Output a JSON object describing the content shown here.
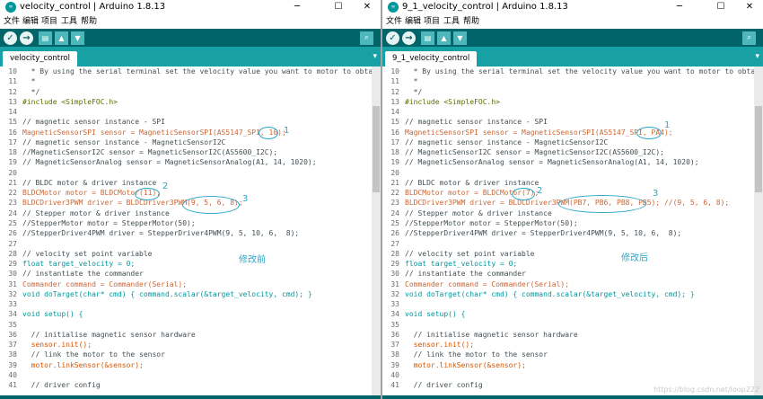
{
  "left": {
    "title": "velocity_control | Arduino 1.8.13",
    "tab": "velocity_control",
    "annotation": "修改前",
    "marks": [
      "1",
      "2",
      "3"
    ]
  },
  "right": {
    "title": "9_1_velocity_control | Arduino 1.8.13",
    "tab": "9_1_velocity_control",
    "annotation": "修改后",
    "marks": [
      "1",
      "2",
      "3"
    ]
  },
  "menu": [
    "文件",
    "编辑",
    "项目",
    "工具",
    "帮助"
  ],
  "window_controls": [
    "─",
    "☐",
    "✕"
  ],
  "icons": {
    "app": "arduino-logo-icon",
    "verify": "verify-check-icon",
    "upload": "upload-arrow-icon",
    "new": "new-file-icon",
    "open": "open-up-icon",
    "save": "save-down-icon",
    "monitor": "serial-monitor-icon",
    "tabmenu": "tab-menu-icon"
  },
  "code_left": [
    {
      "n": "10",
      "t": "  * By using the serial terminal set the velocity value you want to motor to obtain",
      "c": "cmt"
    },
    {
      "n": "11",
      "t": "  *",
      "c": "cmt"
    },
    {
      "n": "12",
      "t": "  */",
      "c": "cmt"
    },
    {
      "n": "13",
      "t": "#include <SimpleFOC.h>",
      "c": "inc"
    },
    {
      "n": "14",
      "t": "",
      "c": ""
    },
    {
      "n": "15",
      "t": "// magnetic sensor instance - SPI",
      "c": "cmt"
    },
    {
      "n": "16",
      "t": "MagneticSensorSPI sensor = MagneticSensorSPI(AS5147_SPI, 10);",
      "c": "ty"
    },
    {
      "n": "17",
      "t": "// magnetic sensor instance - MagneticSensorI2C",
      "c": "cmt"
    },
    {
      "n": "18",
      "t": "//MagneticSensorI2C sensor = MagneticSensorI2C(AS5600_I2C);",
      "c": "cmt"
    },
    {
      "n": "19",
      "t": "// MagneticSensorAnalog sensor = MagneticSensorAnalog(A1, 14, 1020);",
      "c": "cmt"
    },
    {
      "n": "20",
      "t": "",
      "c": ""
    },
    {
      "n": "21",
      "t": "// BLDC motor & driver instance",
      "c": "cmt"
    },
    {
      "n": "22",
      "t": "BLDCMotor motor = BLDCMotor(11);",
      "c": "ty"
    },
    {
      "n": "23",
      "t": "BLDCDriver3PWM driver = BLDCDriver3PWM(9, 5, 6, 8);",
      "c": "ty"
    },
    {
      "n": "24",
      "t": "// Stepper motor & driver instance",
      "c": "cmt"
    },
    {
      "n": "25",
      "t": "//StepperMotor motor = StepperMotor(50);",
      "c": "cmt"
    },
    {
      "n": "26",
      "t": "//StepperDriver4PWM driver = StepperDriver4PWM(9, 5, 10, 6,  8);",
      "c": "cmt"
    },
    {
      "n": "27",
      "t": "",
      "c": ""
    },
    {
      "n": "28",
      "t": "// velocity set point variable",
      "c": "cmt"
    },
    {
      "n": "29",
      "t": "float target_velocity = 0;",
      "c": "kw"
    },
    {
      "n": "30",
      "t": "// instantiate the commander",
      "c": "cmt"
    },
    {
      "n": "31",
      "t": "Commander command = Commander(Serial);",
      "c": "ty"
    },
    {
      "n": "32",
      "t": "void doTarget(char* cmd) { command.scalar(&target_velocity, cmd); }",
      "c": "kw"
    },
    {
      "n": "33",
      "t": "",
      "c": ""
    },
    {
      "n": "34",
      "t": "void setup() {",
      "c": "kw"
    },
    {
      "n": "35",
      "t": "",
      "c": ""
    },
    {
      "n": "36",
      "t": "  // initialise magnetic sensor hardware",
      "c": "cmt"
    },
    {
      "n": "37",
      "t": "  sensor.init();",
      "c": "fn"
    },
    {
      "n": "38",
      "t": "  // link the motor to the sensor",
      "c": "cmt"
    },
    {
      "n": "39",
      "t": "  motor.linkSensor(&sensor);",
      "c": "fn"
    },
    {
      "n": "40",
      "t": "",
      "c": ""
    },
    {
      "n": "41",
      "t": "  // driver config",
      "c": "cmt"
    }
  ],
  "code_right": [
    {
      "n": "10",
      "t": "  * By using the serial terminal set the velocity value you want to motor to obtain",
      "c": "cmt"
    },
    {
      "n": "11",
      "t": "  *",
      "c": "cmt"
    },
    {
      "n": "12",
      "t": "  */",
      "c": "cmt"
    },
    {
      "n": "13",
      "t": "#include <SimpleFOC.h>",
      "c": "inc"
    },
    {
      "n": "14",
      "t": "",
      "c": ""
    },
    {
      "n": "15",
      "t": "// magnetic sensor instance - SPI",
      "c": "cmt"
    },
    {
      "n": "16",
      "t": "MagneticSensorSPI sensor = MagneticSensorSPI(AS5147_SPI, PA4);",
      "c": "ty"
    },
    {
      "n": "17",
      "t": "// magnetic sensor instance - MagneticSensorI2C",
      "c": "cmt"
    },
    {
      "n": "18",
      "t": "// MagneticSensorI2C sensor = MagneticSensorI2C(AS5600_I2C);",
      "c": "cmt"
    },
    {
      "n": "19",
      "t": "// MagneticSensorAnalog sensor = MagneticSensorAnalog(A1, 14, 1020);",
      "c": "cmt"
    },
    {
      "n": "20",
      "t": "",
      "c": ""
    },
    {
      "n": "21",
      "t": "// BLDC motor & driver instance",
      "c": "cmt"
    },
    {
      "n": "22",
      "t": "BLDCMotor motor = BLDCMotor(7);",
      "c": "ty"
    },
    {
      "n": "23",
      "t": "BLDCDriver3PWM driver = BLDCDriver3PWM(PB7, PB6, PB8, PB5); //(9, 5, 6, 8);",
      "c": "ty"
    },
    {
      "n": "24",
      "t": "// Stepper motor & driver instance",
      "c": "cmt"
    },
    {
      "n": "25",
      "t": "//StepperMotor motor = StepperMotor(50);",
      "c": "cmt"
    },
    {
      "n": "26",
      "t": "//StepperDriver4PWM driver = StepperDriver4PWM(9, 5, 10, 6,  8);",
      "c": "cmt"
    },
    {
      "n": "27",
      "t": "",
      "c": ""
    },
    {
      "n": "28",
      "t": "// velocity set point variable",
      "c": "cmt"
    },
    {
      "n": "29",
      "t": "float target_velocity = 0;",
      "c": "kw"
    },
    {
      "n": "30",
      "t": "// instantiate the commander",
      "c": "cmt"
    },
    {
      "n": "31",
      "t": "Commander command = Commander(Serial);",
      "c": "ty"
    },
    {
      "n": "32",
      "t": "void doTarget(char* cmd) { command.scalar(&target_velocity, cmd); }",
      "c": "kw"
    },
    {
      "n": "33",
      "t": "",
      "c": ""
    },
    {
      "n": "34",
      "t": "void setup() {",
      "c": "kw"
    },
    {
      "n": "35",
      "t": "",
      "c": ""
    },
    {
      "n": "36",
      "t": "  // initialise magnetic sensor hardware",
      "c": "cmt"
    },
    {
      "n": "37",
      "t": "  sensor.init();",
      "c": "fn"
    },
    {
      "n": "38",
      "t": "  // link the motor to the sensor",
      "c": "cmt"
    },
    {
      "n": "39",
      "t": "  motor.linkSensor(&sensor);",
      "c": "fn"
    },
    {
      "n": "40",
      "t": "",
      "c": ""
    },
    {
      "n": "41",
      "t": "  // driver config",
      "c": "cmt"
    }
  ],
  "watermark": "https://blog.csdn.net/loop222"
}
